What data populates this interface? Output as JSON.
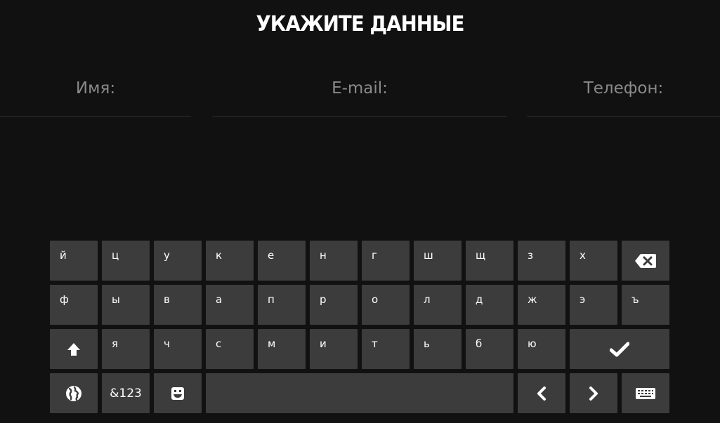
{
  "header": {
    "title": "УКАЖИТЕ ДАННЫЕ"
  },
  "form": {
    "name_label": "Имя:",
    "email_label": "E-mail:",
    "phone_label": "Телефон:"
  },
  "keyboard": {
    "row1": [
      "й",
      "ц",
      "у",
      "к",
      "е",
      "н",
      "г",
      "ш",
      "щ",
      "з",
      "х"
    ],
    "row2": [
      "ф",
      "ы",
      "в",
      "а",
      "п",
      "р",
      "о",
      "л",
      "д",
      "ж",
      "э",
      "ъ"
    ],
    "row3": [
      "я",
      "ч",
      "с",
      "м",
      "и",
      "т",
      "ь",
      "б",
      "ю"
    ],
    "symbols_label": "&123",
    "icons": {
      "backspace": "backspace-icon",
      "shift": "shift-arrow-icon",
      "enter": "checkmark-icon",
      "language": "globe-icon",
      "emoji": "emoji-icon",
      "left": "chevron-left-icon",
      "right": "chevron-right-icon",
      "hide": "keyboard-icon"
    }
  }
}
